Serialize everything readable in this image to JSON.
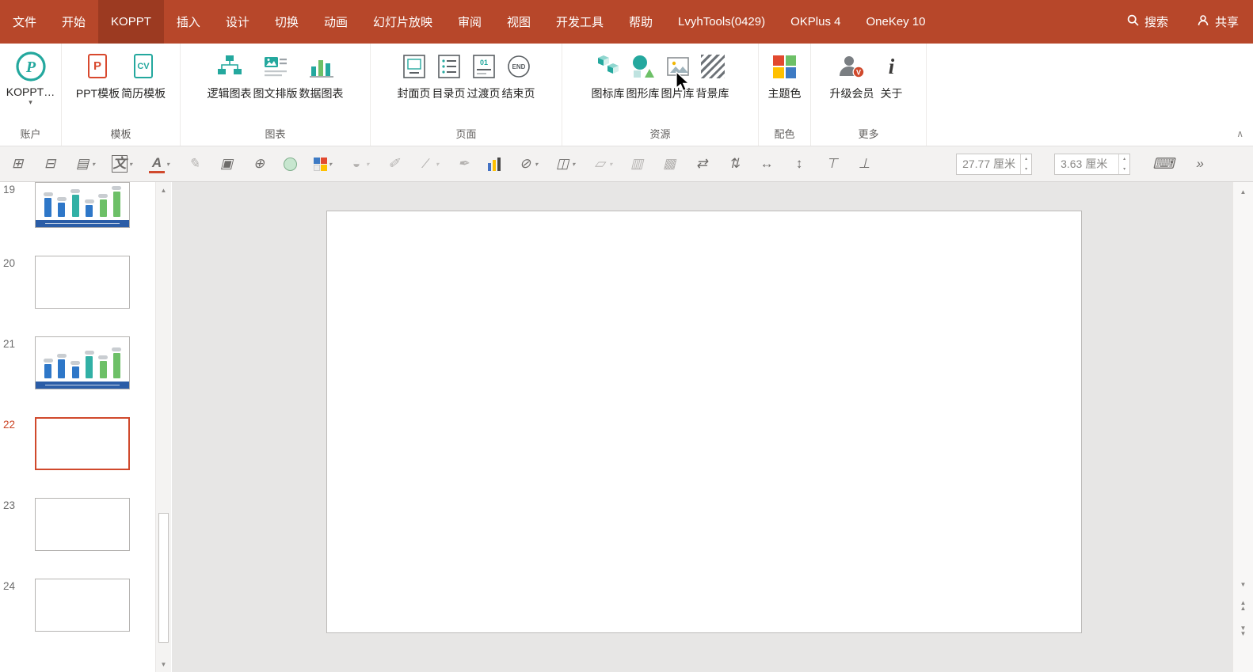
{
  "menubar": {
    "tabs": [
      {
        "label": "文件"
      },
      {
        "label": "开始"
      },
      {
        "label": "KOPPT",
        "active": true
      },
      {
        "label": "插入"
      },
      {
        "label": "设计"
      },
      {
        "label": "切换"
      },
      {
        "label": "动画"
      },
      {
        "label": "幻灯片放映"
      },
      {
        "label": "审阅"
      },
      {
        "label": "视图"
      },
      {
        "label": "开发工具"
      },
      {
        "label": "帮助"
      },
      {
        "label": "LvyhTools(0429)"
      },
      {
        "label": "OKPlus 4"
      },
      {
        "label": "OneKey 10"
      }
    ],
    "search_label": "搜索",
    "share_label": "共享"
  },
  "ribbon": {
    "caret_glyph": "▾",
    "collapse_glyph": "∧",
    "icon_glyphs": {
      "logo_p": "P",
      "ppt_p": "P",
      "cv": "CV",
      "page01": "01",
      "end": "END",
      "badge_v": "V",
      "info_i": "i"
    },
    "groups": [
      {
        "label": "账户",
        "buttons": [
          {
            "label": "KOPPT…"
          }
        ]
      },
      {
        "label": "模板",
        "buttons": [
          {
            "label": "PPT模板"
          },
          {
            "label": "简历模板"
          }
        ]
      },
      {
        "label": "图表",
        "buttons": [
          {
            "label": "逻辑图表"
          },
          {
            "label": "图文排版"
          },
          {
            "label": "数据图表"
          }
        ]
      },
      {
        "label": "页面",
        "buttons": [
          {
            "label": "封面页"
          },
          {
            "label": "目录页"
          },
          {
            "label": "过渡页"
          },
          {
            "label": "结束页"
          }
        ]
      },
      {
        "label": "资源",
        "buttons": [
          {
            "label": "图标库"
          },
          {
            "label": "图形库"
          },
          {
            "label": "图片库"
          },
          {
            "label": "背景库"
          }
        ]
      },
      {
        "label": "配色",
        "buttons": [
          {
            "label": "主题色"
          }
        ]
      },
      {
        "label": "更多",
        "buttons": [
          {
            "label": "升级会员"
          },
          {
            "label": "关于"
          }
        ]
      }
    ]
  },
  "toolbar2": {
    "caret": "▾",
    "spinner_up": "▴",
    "spinner_down": "▾",
    "icons": [
      {
        "name": "align-objects",
        "glyph": "⊞"
      },
      {
        "name": "distribute-objects",
        "glyph": "⊟"
      },
      {
        "name": "text-box",
        "glyph": "▤"
      },
      {
        "name": "text-format",
        "glyph": "文"
      },
      {
        "name": "font-color",
        "glyph": "A"
      },
      {
        "name": "format-painter",
        "glyph": "✎"
      },
      {
        "name": "picture-paste",
        "glyph": "▣"
      },
      {
        "name": "pin",
        "glyph": "⊕"
      },
      {
        "name": "shape-fill-swatch",
        "glyph": ""
      },
      {
        "name": "color-palette",
        "glyph": ""
      },
      {
        "name": "fill-color",
        "glyph": "◒"
      },
      {
        "name": "eyedropper",
        "glyph": "✐"
      },
      {
        "name": "line-color",
        "glyph": "∕"
      },
      {
        "name": "ink-eyedropper",
        "glyph": "✒"
      },
      {
        "name": "chart-colors",
        "glyph": ""
      },
      {
        "name": "no-fill",
        "glyph": "⊘"
      },
      {
        "name": "merge-shapes",
        "glyph": "◫"
      },
      {
        "name": "skew-shape",
        "glyph": "▱"
      },
      {
        "name": "bring-forward",
        "glyph": "▥"
      },
      {
        "name": "send-backward",
        "glyph": "▩"
      },
      {
        "name": "swap-position",
        "glyph": "⇄"
      },
      {
        "name": "swap-size",
        "glyph": "⇅"
      },
      {
        "name": "same-width",
        "glyph": "↔"
      },
      {
        "name": "same-height",
        "glyph": "↕"
      },
      {
        "name": "align-top",
        "glyph": "⊤"
      },
      {
        "name": "align-bottom",
        "glyph": "⊥"
      }
    ],
    "width_value": "27.77 厘米",
    "height_value": "3.63 厘米",
    "keyboard_glyph": "⌨",
    "overflow_glyph": "»"
  },
  "slide_panel": {
    "slides": [
      {
        "number": "19",
        "content": "chart"
      },
      {
        "number": "20",
        "content": "blank"
      },
      {
        "number": "21",
        "content": "chart"
      },
      {
        "number": "22",
        "content": "blank",
        "selected": true
      },
      {
        "number": "23",
        "content": "blank"
      },
      {
        "number": "24",
        "content": "blank"
      }
    ]
  },
  "scrollbar": {
    "up_glyph": "▲",
    "down_glyph": "▼"
  }
}
